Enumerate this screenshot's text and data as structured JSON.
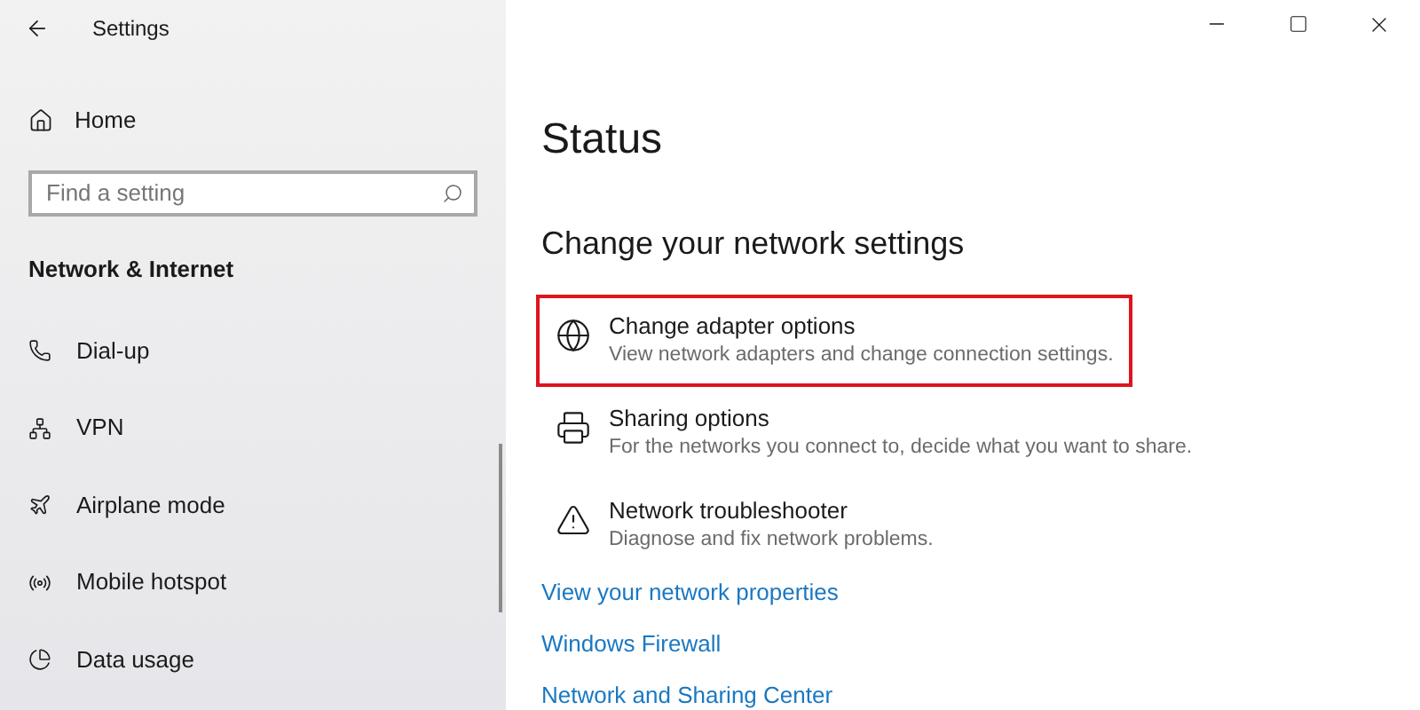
{
  "window": {
    "title": "Settings"
  },
  "sidebar": {
    "home": "Home",
    "search": {
      "placeholder": "Find a setting"
    },
    "section": "Network & Internet",
    "items": [
      {
        "label": "Dial-up"
      },
      {
        "label": "VPN"
      },
      {
        "label": "Airplane mode"
      },
      {
        "label": "Mobile hotspot"
      },
      {
        "label": "Data usage"
      }
    ]
  },
  "main": {
    "title": "Status",
    "subtitle": "Change your network settings",
    "options": [
      {
        "title": "Change adapter options",
        "description": "View network adapters and change connection settings.",
        "highlighted": true
      },
      {
        "title": "Sharing options",
        "description": "For the networks you connect to, decide what you want to share.",
        "highlighted": false
      },
      {
        "title": "Network troubleshooter",
        "description": "Diagnose and fix network problems.",
        "highlighted": false
      }
    ],
    "links": [
      "View your network properties",
      "Windows Firewall",
      "Network and Sharing Center"
    ]
  }
}
